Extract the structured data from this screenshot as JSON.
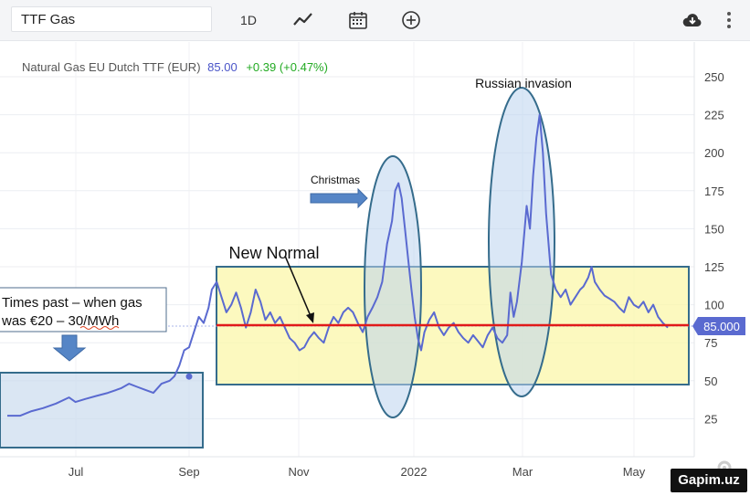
{
  "toolbar": {
    "symbol": "TTF Gas",
    "interval": "1D",
    "icons": [
      "line-chart-icon",
      "calendar-icon",
      "add-indicator-icon",
      "cloud-download-icon",
      "more-vert-icon"
    ]
  },
  "header": {
    "instrument": "Natural Gas EU Dutch TTF (EUR)",
    "price": "85.00",
    "change": "+0.39 (+0.47%)",
    "price_color": "#4a55c8",
    "change_color": "#22aa22"
  },
  "chart_data": {
    "type": "line",
    "x_tick_labels": [
      "Jul",
      "Sep",
      "Nov",
      "2022",
      "Mar",
      "May"
    ],
    "y_ticks": [
      25,
      50,
      75,
      100,
      125,
      150,
      175,
      200,
      225,
      250
    ],
    "ylim": [
      0,
      260
    ],
    "last_price_label": "85.000",
    "line_color": "#5a6ad0",
    "series": [
      {
        "values": [
          [
            0,
            27
          ],
          [
            8,
            27
          ],
          [
            15,
            30
          ],
          [
            22,
            32
          ],
          [
            30,
            35
          ],
          [
            38,
            39
          ],
          [
            42,
            36
          ],
          [
            48,
            38
          ],
          [
            55,
            40
          ],
          [
            62,
            42
          ],
          [
            70,
            45
          ],
          [
            75,
            48
          ],
          [
            80,
            46
          ],
          [
            85,
            44
          ],
          [
            90,
            42
          ],
          [
            95,
            48
          ],
          [
            100,
            50
          ],
          [
            103,
            53
          ],
          [
            106,
            60
          ],
          [
            109,
            70
          ],
          [
            112,
            72
          ],
          [
            115,
            82
          ],
          [
            118,
            92
          ],
          [
            121,
            88
          ],
          [
            124,
            98
          ],
          [
            126,
            110
          ],
          [
            129,
            115
          ],
          [
            132,
            105
          ],
          [
            135,
            95
          ],
          [
            138,
            100
          ],
          [
            141,
            108
          ],
          [
            144,
            98
          ],
          [
            147,
            85
          ],
          [
            150,
            95
          ],
          [
            153,
            110
          ],
          [
            156,
            102
          ],
          [
            159,
            90
          ],
          [
            162,
            95
          ],
          [
            165,
            88
          ],
          [
            168,
            92
          ],
          [
            171,
            85
          ],
          [
            174,
            78
          ],
          [
            177,
            75
          ],
          [
            180,
            70
          ],
          [
            183,
            72
          ],
          [
            186,
            78
          ],
          [
            189,
            82
          ],
          [
            192,
            78
          ],
          [
            195,
            75
          ],
          [
            198,
            85
          ],
          [
            201,
            92
          ],
          [
            204,
            88
          ],
          [
            207,
            95
          ],
          [
            210,
            98
          ],
          [
            213,
            95
          ],
          [
            216,
            88
          ],
          [
            219,
            82
          ],
          [
            222,
            92
          ],
          [
            225,
            98
          ],
          [
            228,
            105
          ],
          [
            231,
            115
          ],
          [
            234,
            140
          ],
          [
            237,
            155
          ],
          [
            239,
            175
          ],
          [
            241,
            180
          ],
          [
            243,
            170
          ],
          [
            245,
            150
          ],
          [
            247,
            130
          ],
          [
            249,
            110
          ],
          [
            251,
            92
          ],
          [
            253,
            78
          ],
          [
            255,
            70
          ],
          [
            257,
            82
          ],
          [
            260,
            90
          ],
          [
            263,
            95
          ],
          [
            266,
            85
          ],
          [
            269,
            80
          ],
          [
            272,
            85
          ],
          [
            275,
            88
          ],
          [
            278,
            82
          ],
          [
            281,
            78
          ],
          [
            284,
            75
          ],
          [
            287,
            80
          ],
          [
            290,
            76
          ],
          [
            293,
            72
          ],
          [
            296,
            80
          ],
          [
            299,
            85
          ],
          [
            302,
            78
          ],
          [
            305,
            75
          ],
          [
            308,
            80
          ],
          [
            310,
            108
          ],
          [
            312,
            92
          ],
          [
            314,
            102
          ],
          [
            317,
            128
          ],
          [
            320,
            165
          ],
          [
            322,
            150
          ],
          [
            324,
            185
          ],
          [
            326,
            210
          ],
          [
            328,
            225
          ],
          [
            330,
            200
          ],
          [
            332,
            160
          ],
          [
            335,
            120
          ],
          [
            338,
            110
          ],
          [
            341,
            105
          ],
          [
            344,
            110
          ],
          [
            347,
            100
          ],
          [
            350,
            105
          ],
          [
            353,
            110
          ],
          [
            355,
            112
          ],
          [
            358,
            118
          ],
          [
            360,
            125
          ],
          [
            362,
            115
          ],
          [
            365,
            110
          ],
          [
            368,
            106
          ],
          [
            371,
            104
          ],
          [
            374,
            102
          ],
          [
            377,
            98
          ],
          [
            380,
            95
          ],
          [
            383,
            105
          ],
          [
            386,
            100
          ],
          [
            389,
            98
          ],
          [
            392,
            102
          ],
          [
            395,
            95
          ],
          [
            398,
            100
          ],
          [
            401,
            92
          ],
          [
            404,
            88
          ],
          [
            407,
            85
          ]
        ]
      }
    ]
  },
  "annotations": {
    "russian_invasion": "Russian invasion",
    "christmas": "Christmas",
    "new_normal": "New Normal",
    "times_past_line1": "Times past – when gas",
    "times_past_line2": "was €20 – 30/MWh"
  },
  "watermark": "Gapim.uz"
}
